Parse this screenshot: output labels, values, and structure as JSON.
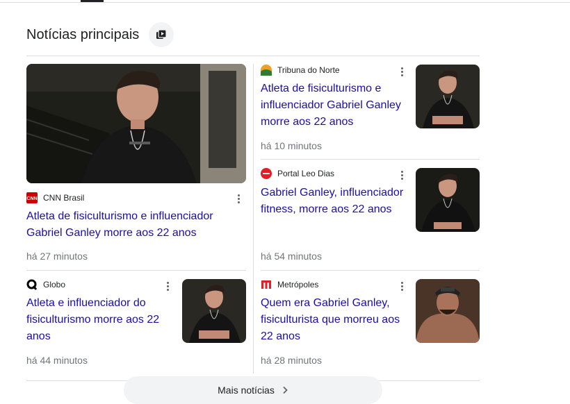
{
  "section": {
    "title": "Notícias principais"
  },
  "articles": [
    {
      "source": "CNN Brasil",
      "title": "Atleta de fisiculturismo e influenciador Gabriel Ganley morre aos 22 anos",
      "time": "há 27 minutos",
      "logo": "cnn-logo"
    },
    {
      "source": "Tribuna do Norte",
      "title": "Atleta de fisiculturismo e influenciador Gabriel Ganley morre aos 22 anos",
      "time": "há 10 minutos",
      "logo": "tribuna-logo"
    },
    {
      "source": "Portal Leo Dias",
      "title": "Gabriel Ganley, influenciador fitness, morre aos 22 anos",
      "time": "há 54 minutos",
      "logo": "leodias-logo"
    },
    {
      "source": "Globo",
      "title": "Atleta e influenciador do fisiculturismo morre aos 22 anos",
      "time": "há 44 minutos",
      "logo": "globo-logo"
    },
    {
      "source": "Metrópoles",
      "title": "Quem era Gabriel Ganley, fisiculturista que morreu aos 22 anos",
      "time": "há 28 minutos",
      "logo": "metropoles-logo"
    }
  ],
  "more_button": {
    "label": "Mais notícias"
  }
}
